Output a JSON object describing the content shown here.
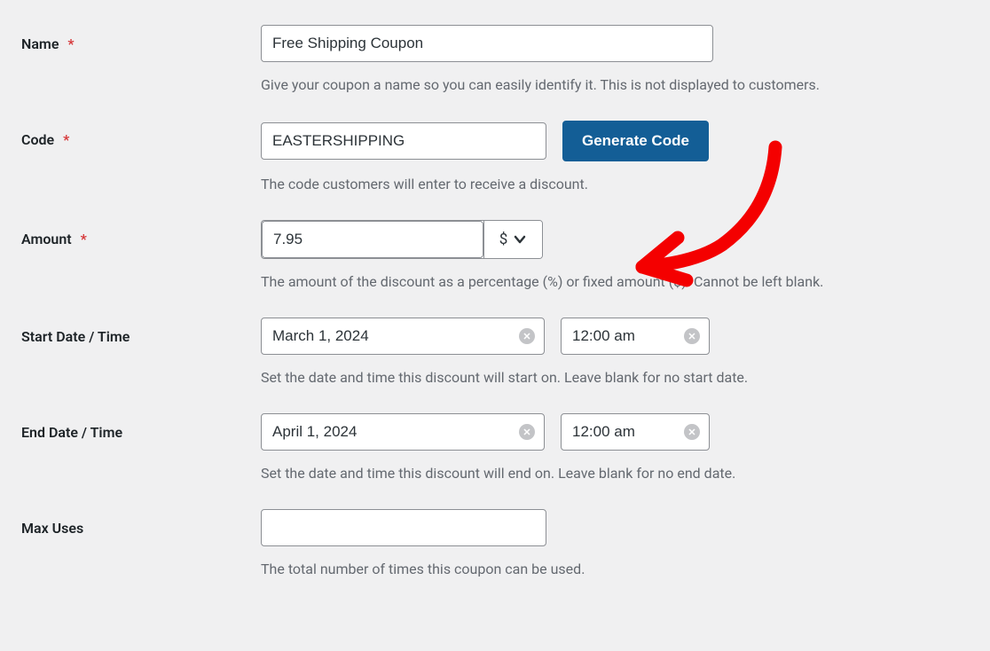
{
  "fields": {
    "name": {
      "label": "Name",
      "required": "*",
      "value": "Free Shipping Coupon",
      "help": "Give your coupon a name so you can easily identify it. This is not displayed to customers."
    },
    "code": {
      "label": "Code",
      "required": "*",
      "value": "EASTERSHIPPING",
      "generate_label": "Generate Code",
      "help": "The code customers will enter to receive a discount."
    },
    "amount": {
      "label": "Amount",
      "required": "*",
      "value": "7.95",
      "unit": "$",
      "help": "The amount of the discount as a percentage (%) or fixed amount ($). Cannot be left blank."
    },
    "start": {
      "label": "Start Date / Time",
      "date": "March 1, 2024",
      "time": "12:00 am",
      "help": "Set the date and time this discount will start on. Leave blank for no start date."
    },
    "end": {
      "label": "End Date / Time",
      "date": "April 1, 2024",
      "time": "12:00 am",
      "help": "Set the date and time this discount will end on. Leave blank for no end date."
    },
    "max_uses": {
      "label": "Max Uses",
      "value": "",
      "help": "The total number of times this coupon can be used."
    }
  }
}
